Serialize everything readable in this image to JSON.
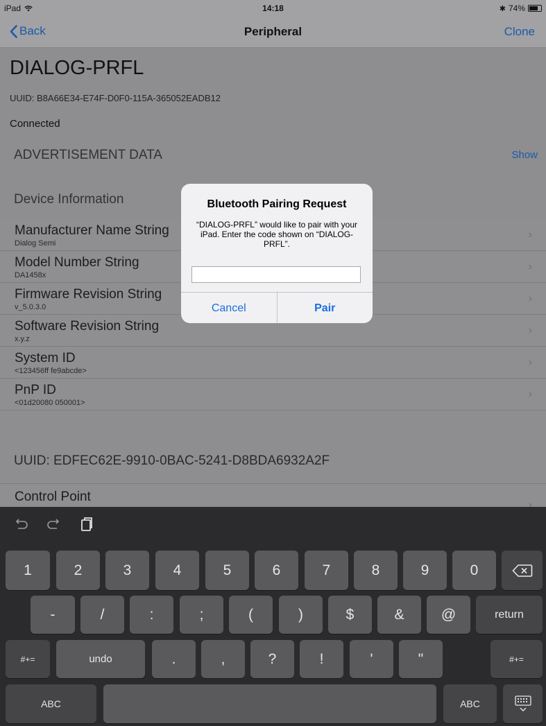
{
  "status_bar": {
    "device": "iPad",
    "time": "14:18",
    "battery": "74%"
  },
  "nav": {
    "back_label": "Back",
    "title": "Peripheral",
    "clone_label": "Clone"
  },
  "device": {
    "name": "DIALOG-PRFL",
    "uuid": "UUID: B8A66E34-E74F-D0F0-115A-365052EADB12",
    "status": "Connected"
  },
  "advertisement": {
    "title": "ADVERTISEMENT DATA",
    "show_label": "Show"
  },
  "device_info": {
    "title": "Device Information",
    "rows": [
      {
        "title": "Manufacturer Name String",
        "value": "Dialog Semi"
      },
      {
        "title": "Model Number String",
        "value": "DA1458x"
      },
      {
        "title": "Firmware Revision String",
        "value": "v_5.0.3.0"
      },
      {
        "title": "Software Revision String",
        "value": "x.y.z"
      },
      {
        "title": "System ID",
        "value": "<123456ff fe9abcde>"
      },
      {
        "title": "PnP ID",
        "value": "<01d20080 050001>"
      }
    ]
  },
  "service2": {
    "uuid_title": "UUID: EDFEC62E-9910-0BAC-5241-D8BDA6932A2F",
    "row_title": "Control Point"
  },
  "alert": {
    "title": "Bluetooth Pairing Request",
    "message": "“DIALOG-PRFL” would like to pair with your iPad. Enter the code shown on “DIALOG-PRFL”.",
    "input_value": "",
    "cancel_label": "Cancel",
    "pair_label": "Pair"
  },
  "keyboard": {
    "row1": [
      "1",
      "2",
      "3",
      "4",
      "5",
      "6",
      "7",
      "8",
      "9",
      "0"
    ],
    "row2": [
      "-",
      "/",
      ":",
      ";",
      "(",
      ")",
      "$",
      "&",
      "@"
    ],
    "return_label": "return",
    "row3_left": "#+=",
    "undo_label": "undo",
    "row3": [
      ".",
      ",",
      "?",
      "!",
      "'",
      "\""
    ],
    "row3_right": "#+=",
    "abc_left": "ABC",
    "abc_right": "ABC",
    "chevron_char": "›"
  }
}
